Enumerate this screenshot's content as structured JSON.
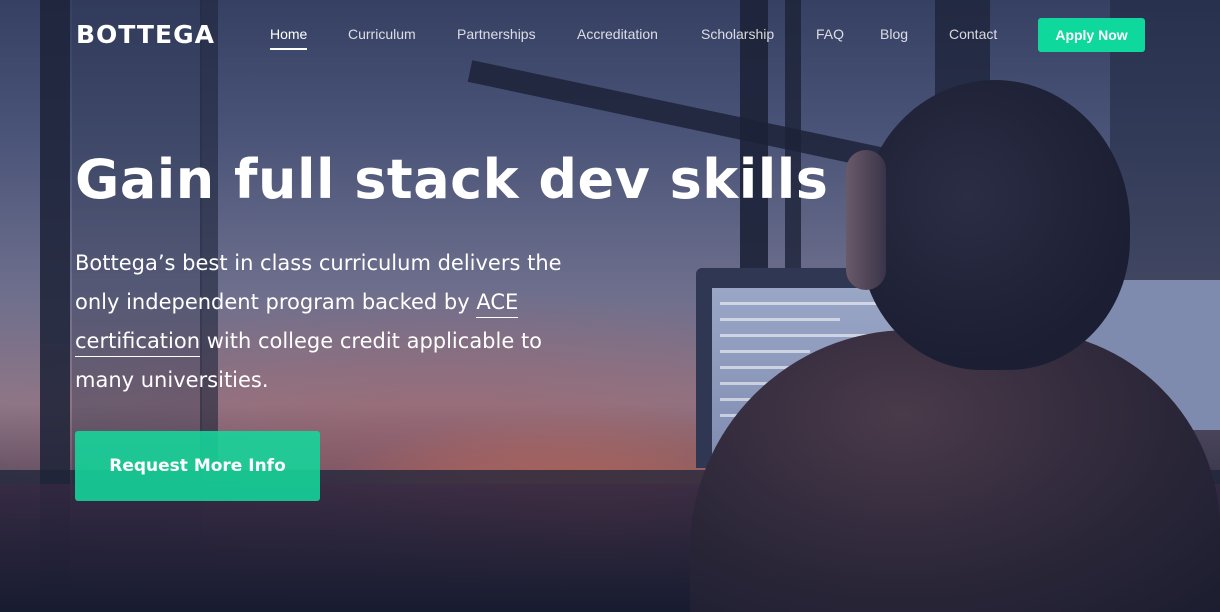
{
  "brand": {
    "logo_text": "BOTTEGA",
    "accent_color": "#0fd89c"
  },
  "nav": {
    "items": [
      {
        "label": "Home",
        "active": true
      },
      {
        "label": "Curriculum",
        "active": false
      },
      {
        "label": "Partnerships",
        "active": false
      },
      {
        "label": "Accreditation",
        "active": false
      },
      {
        "label": "Scholarship",
        "active": false
      },
      {
        "label": "FAQ",
        "active": false
      },
      {
        "label": "Blog",
        "active": false
      },
      {
        "label": "Contact",
        "active": false
      }
    ],
    "apply_label": "Apply Now"
  },
  "hero": {
    "headline": "Gain full stack dev skills",
    "lead_before": "Bottega’s best in class curriculum delivers the only independent program backed by ",
    "lead_link": "ACE certification",
    "lead_after": " with college credit applicable to many universities.",
    "cta_label": "Request More Info"
  }
}
